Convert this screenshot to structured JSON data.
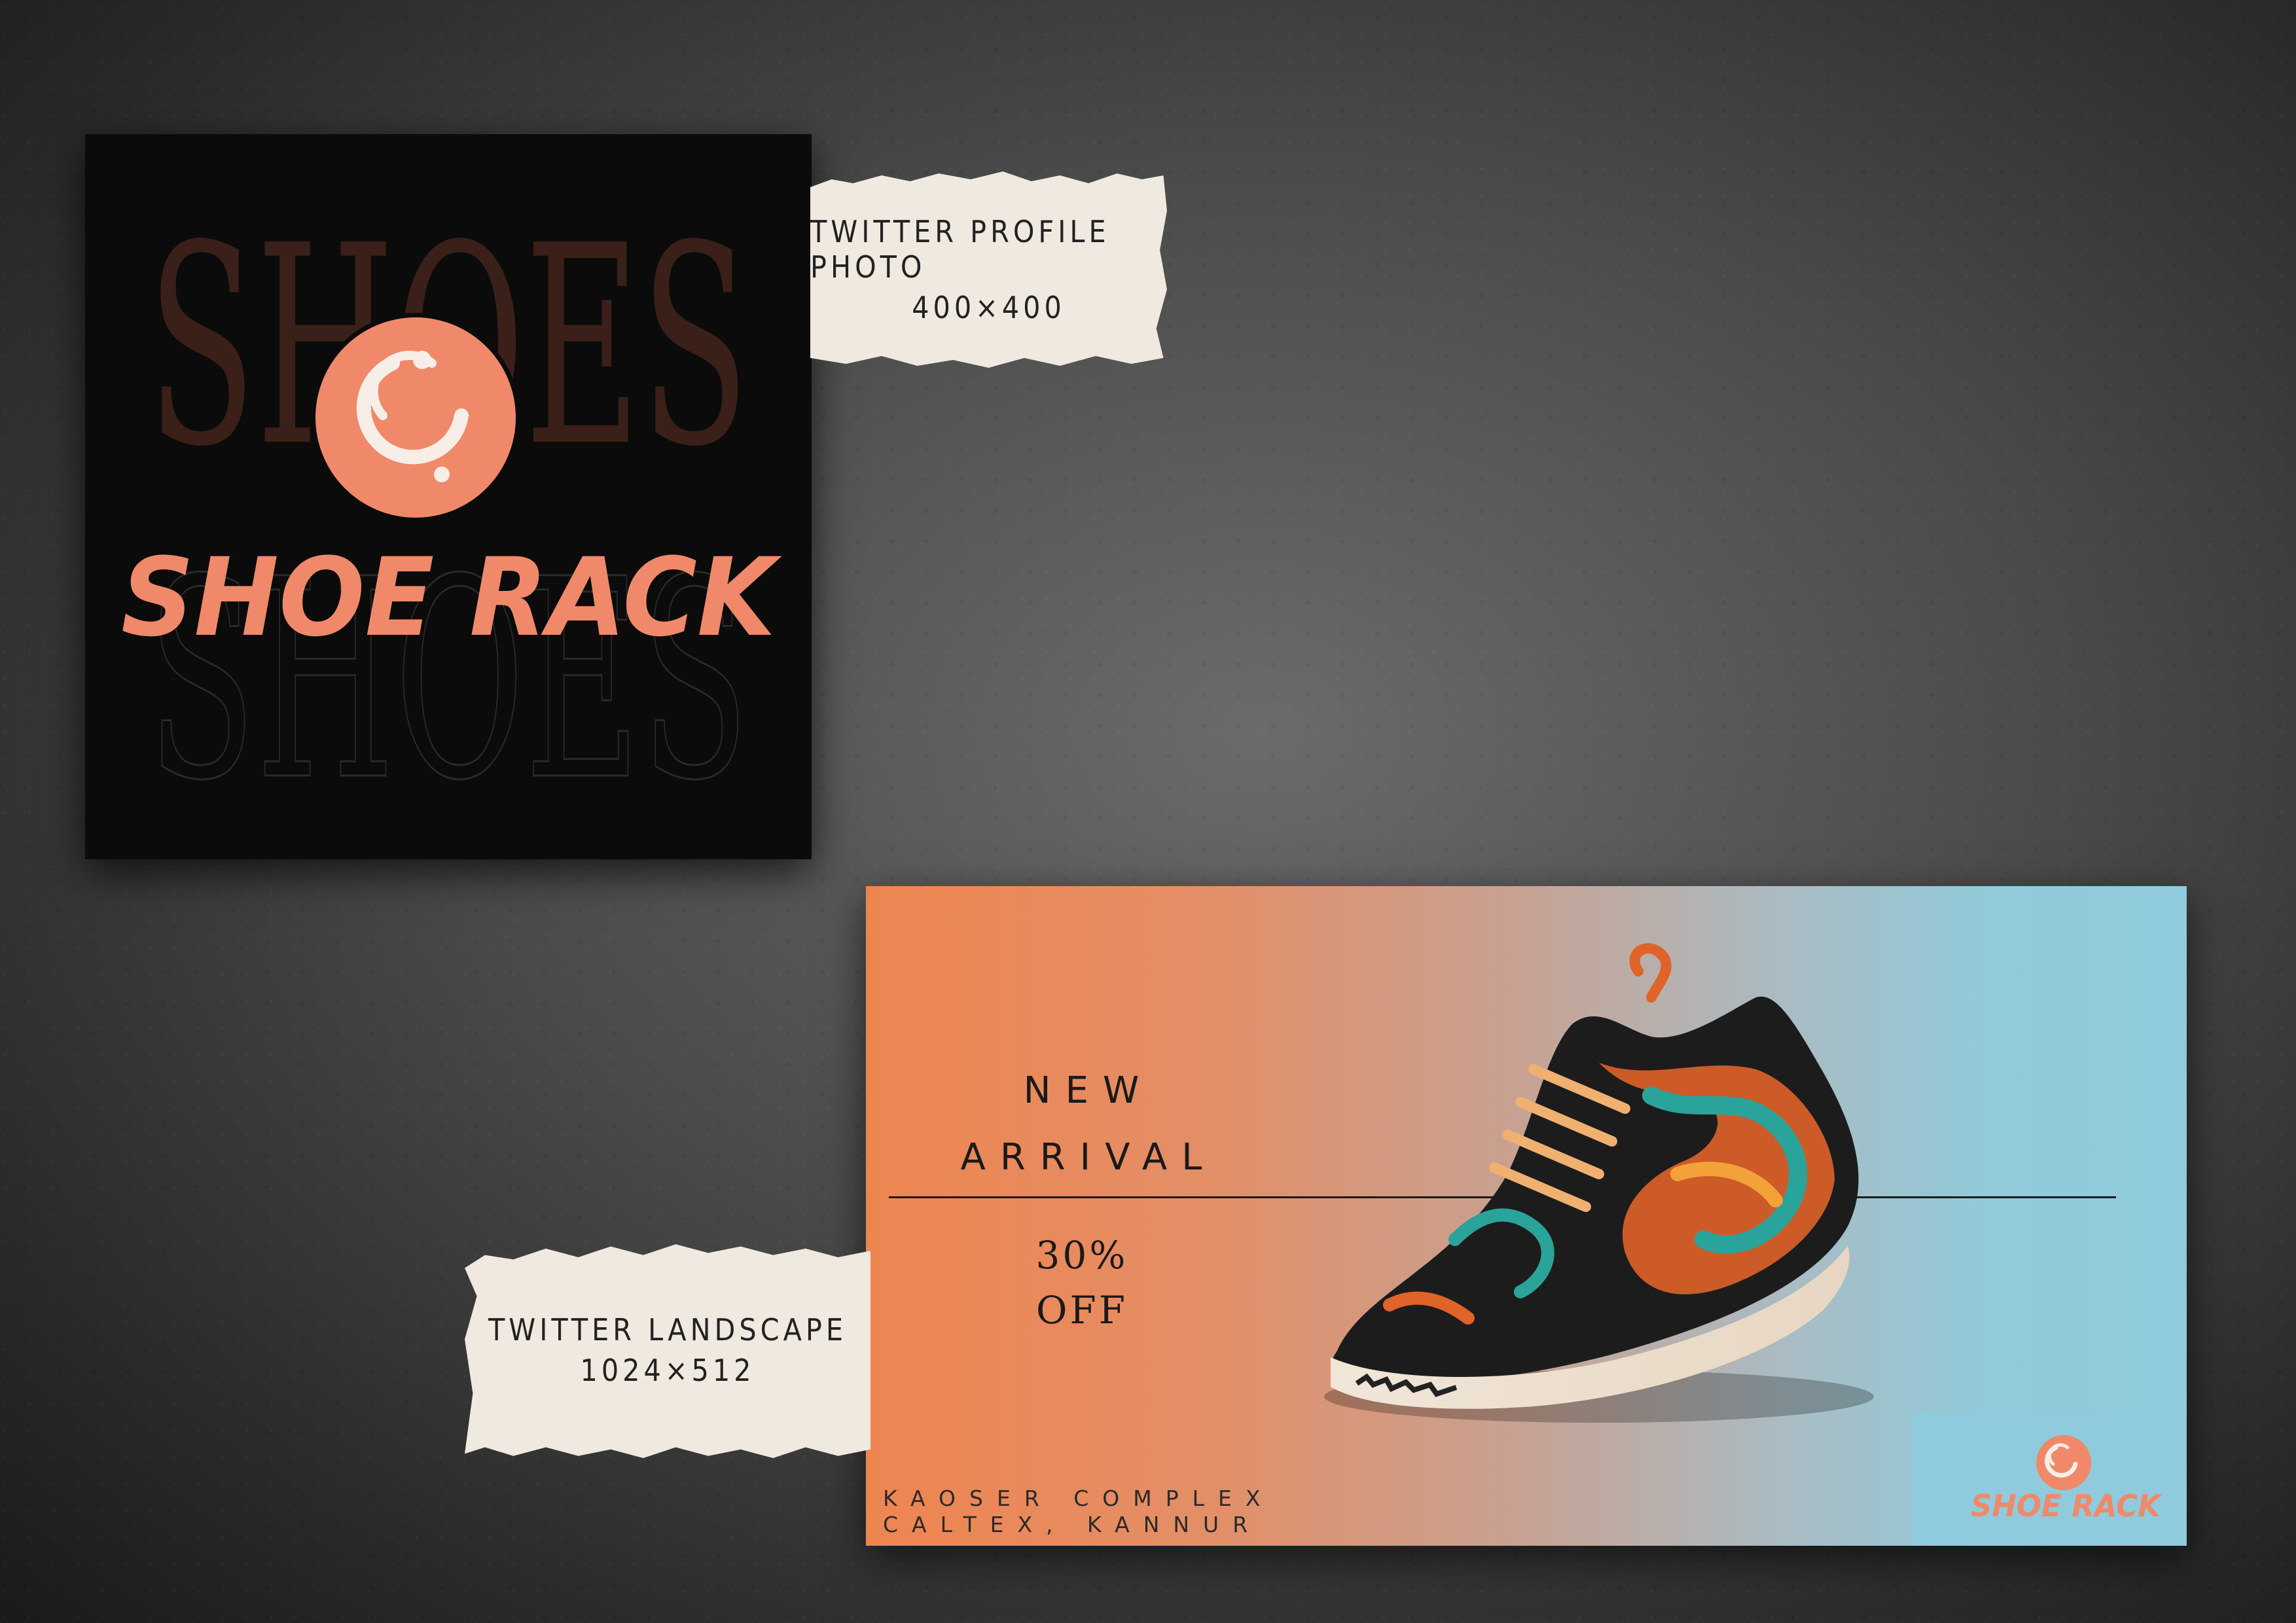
{
  "profile": {
    "bg_word": "SHOES",
    "brand": "SHOE RACK",
    "accent": "#f0896a",
    "bg_color": "#0b0b0b"
  },
  "labels": {
    "profile_label_line1": "TWITTER PROFILE PHOTO",
    "profile_label_line2": "400×400",
    "landscape_label_line1": "TWITTER LANDSCAPE",
    "landscape_label_line2": "1024×512"
  },
  "banner": {
    "new": "NEW",
    "arrival": "ARRIVAL",
    "discount_line1": "30%",
    "discount_line2": "OFF",
    "address_line1": "KAOSER COMPLEX",
    "address_line2": "CALTEX, KANNUR",
    "brand": "SHOE RACK",
    "gradient_start": "#ee8550",
    "gradient_end": "#8fcbdc"
  }
}
